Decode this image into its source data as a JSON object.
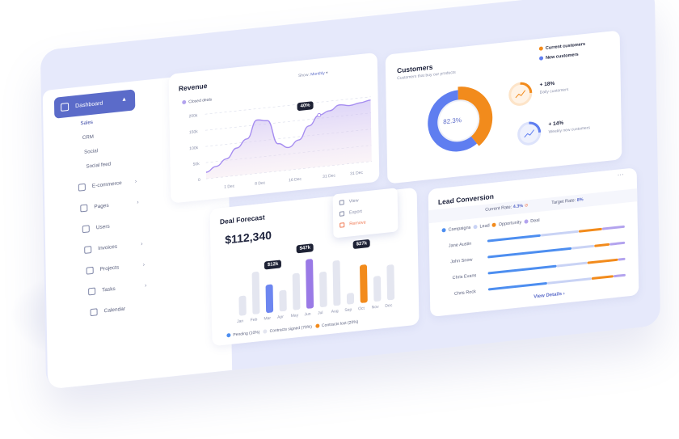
{
  "sidebar": {
    "main": "Dashboard",
    "sub": [
      "Sales",
      "CRM",
      "Social",
      "Social feed"
    ],
    "items": [
      {
        "label": "E-commerce",
        "icon": "shopping-bag-icon",
        "arrow": true
      },
      {
        "label": "Pages",
        "icon": "pages-icon",
        "arrow": true
      },
      {
        "label": "Users",
        "icon": "users-icon",
        "arrow": false
      },
      {
        "label": "Invoices",
        "icon": "invoice-icon",
        "arrow": true
      },
      {
        "label": "Projects",
        "icon": "projects-icon",
        "arrow": true
      },
      {
        "label": "Tasks",
        "icon": "tasks-icon",
        "arrow": true
      },
      {
        "label": "Calendar",
        "icon": "calendar-icon",
        "arrow": false
      }
    ]
  },
  "revenue": {
    "title": "Revenue",
    "show_label": "Show:",
    "show_value": "Monthly",
    "legend": "Closed deals",
    "tooltip": "40%",
    "chart_data": {
      "type": "area",
      "y_ticks": [
        "200k",
        "150k",
        "100k",
        "50k",
        "0"
      ],
      "x_ticks": [
        "1 Dec",
        "8 Dec",
        "16 Dec",
        "31 Dec",
        "31 Dec"
      ],
      "ylim": [
        0,
        200000
      ],
      "x": [
        0,
        1,
        2,
        3,
        4,
        5,
        6,
        7,
        8,
        9,
        10,
        11,
        12,
        13,
        14,
        15,
        16
      ],
      "values": [
        20000,
        35000,
        55000,
        85000,
        110000,
        165000,
        160000,
        85000,
        70000,
        90000,
        130000,
        160000,
        170000,
        185000,
        180000,
        185000,
        190000
      ]
    }
  },
  "customers": {
    "title": "Customers",
    "subtitle": "Customers that buy our products",
    "center": "82.3%",
    "legend": [
      {
        "label": "Current customers",
        "color": "#f28b1c"
      },
      {
        "label": "New customers",
        "color": "#5f7ef0"
      }
    ],
    "stats": [
      {
        "value": "+ 18%",
        "label": "Daily customers",
        "color": "#f28b1c"
      },
      {
        "value": "+ 14%",
        "label": "Weekly new customers",
        "color": "#5f7ef0"
      }
    ],
    "chart_data": {
      "type": "pie",
      "categories": [
        "Current customers",
        "New customers"
      ],
      "values": [
        40,
        60
      ]
    }
  },
  "deal": {
    "title": "Deal Forecast",
    "amount": "$112,340",
    "menu": [
      "View",
      "Export",
      "Remove"
    ],
    "tags": [
      "$12k",
      "$47k",
      "$27k"
    ],
    "legend": [
      "Pending (10%)",
      "Contracts signed (70%)",
      "Contracts lost (20%)"
    ],
    "chart_data": {
      "type": "bar",
      "categories": [
        "Jan",
        "Feb",
        "Mar",
        "Apr",
        "May",
        "Jun",
        "Jul",
        "Aug",
        "Sep",
        "Oct",
        "Nov",
        "Dec"
      ],
      "values": [
        14,
        30,
        20,
        15,
        26,
        35,
        25,
        32,
        8,
        27,
        18,
        25
      ],
      "colors": [
        "#e4e6f0",
        "#e4e6f0",
        "#6d86f0",
        "#e4e6f0",
        "#e4e6f0",
        "#9a7ae6",
        "#e4e6f0",
        "#e4e6f0",
        "#e4e6f0",
        "#f28b1c",
        "#e4e6f0",
        "#e4e6f0"
      ]
    }
  },
  "lead": {
    "title": "Lead Conversion",
    "current_label": "Current Rate:",
    "current_value": "4.3%",
    "target_label": "Target Rate:",
    "target_value": "8%",
    "legend": [
      {
        "label": "Campaigns",
        "color": "#4d8ef0"
      },
      {
        "label": "Lead",
        "color": "#c9d3f5"
      },
      {
        "label": "Opportunity",
        "color": "#f28b1c"
      },
      {
        "label": "Deal",
        "color": "#b3a3ee"
      }
    ],
    "people": [
      "Jane Austin",
      "John Snow",
      "Chris Evans",
      "Chris Rock"
    ],
    "link": "View Details",
    "chart_data": {
      "type": "bar",
      "categories": [
        "Jane Austin",
        "John Snow",
        "Chris Evans",
        "Chris Rock"
      ],
      "series": [
        {
          "name": "Campaigns",
          "values": [
            35,
            55,
            45,
            40
          ]
        },
        {
          "name": "Lead",
          "values": [
            25,
            15,
            20,
            30
          ]
        },
        {
          "name": "Opportunity",
          "values": [
            15,
            10,
            20,
            15
          ]
        },
        {
          "name": "Deal",
          "values": [
            15,
            10,
            5,
            8
          ]
        }
      ]
    }
  }
}
